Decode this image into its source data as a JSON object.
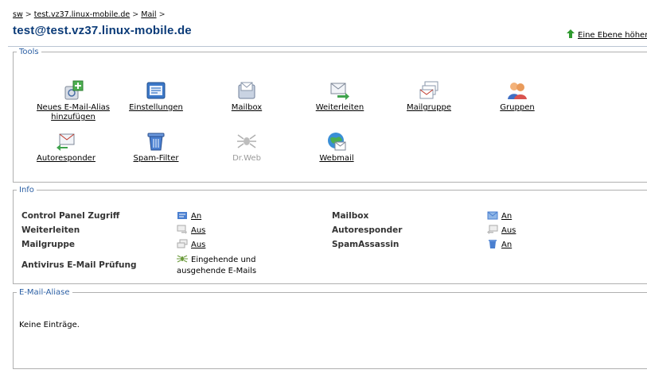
{
  "breadcrumb": {
    "items": [
      "sw",
      "test.vz37.linux-mobile.de",
      "Mail"
    ],
    "separator": ">"
  },
  "page_title": "test@test.vz37.linux-mobile.de",
  "up_level_label": "Eine Ebene höher",
  "tools": {
    "legend": "Tools",
    "items": [
      {
        "label": "Neues E-Mail-Alias hinzufügen",
        "icon": "add-alias-icon",
        "enabled": true
      },
      {
        "label": "Einstellungen",
        "icon": "settings-card-icon",
        "enabled": true
      },
      {
        "label": "Mailbox",
        "icon": "mailbox-icon",
        "enabled": true
      },
      {
        "label": "Weiterleiten",
        "icon": "forward-mail-icon",
        "enabled": true
      },
      {
        "label": "Mailgruppe",
        "icon": "mailgroup-icon",
        "enabled": true
      },
      {
        "label": "Gruppen",
        "icon": "groups-icon",
        "enabled": true
      },
      {
        "label": "Autoresponder",
        "icon": "autoresponder-icon",
        "enabled": true
      },
      {
        "label": "Spam-Filter",
        "icon": "spam-filter-icon",
        "enabled": true
      },
      {
        "label": "Dr.Web",
        "icon": "drweb-spider-icon",
        "enabled": false
      },
      {
        "label": "Webmail",
        "icon": "webmail-globe-icon",
        "enabled": true
      }
    ]
  },
  "info": {
    "legend": "Info",
    "rows": [
      {
        "label": "Control Panel Zugriff",
        "value": "An"
      },
      {
        "label": "Weiterleiten",
        "value": "Aus"
      },
      {
        "label": "Mailgruppe",
        "value": "Aus"
      },
      {
        "label": "Antivirus E-Mail Prüfung",
        "value": "Eingehende und ausgehende E-Mails"
      },
      {
        "label": "Mailbox",
        "value": "An"
      },
      {
        "label": "Autoresponder",
        "value": "Aus"
      },
      {
        "label": "SpamAssassin",
        "value": "An"
      }
    ]
  },
  "aliases": {
    "legend": "E-Mail-Aliase",
    "empty_text": "Keine Einträge."
  },
  "colors": {
    "title": "#0b3b78",
    "legend": "#2b5fa4",
    "border": "#b0b0b0",
    "disabled": "#9a9a9a"
  }
}
